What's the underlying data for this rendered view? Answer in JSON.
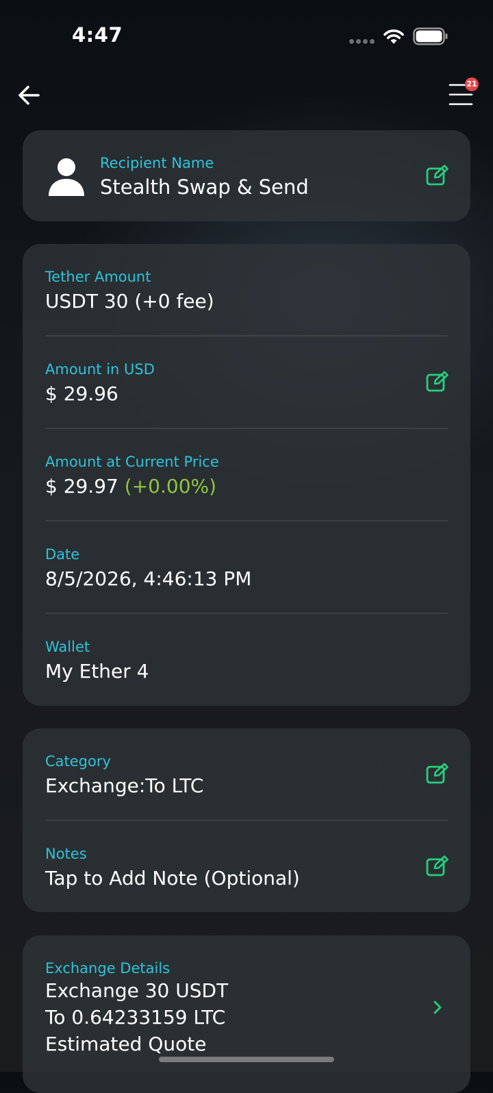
{
  "status_bar": {
    "time": "4:47"
  },
  "nav": {
    "back_icon": "arrow-left-icon",
    "menu_icon": "hamburger-menu-icon",
    "notification_count": "21"
  },
  "recipient": {
    "label": "Recipient Name",
    "value": "Stealth Swap & Send"
  },
  "amounts": {
    "tether_amount": {
      "label": "Tether Amount",
      "value": "USDT 30 (+0 fee)"
    },
    "amount_usd": {
      "label": "Amount in USD",
      "value": "$ 29.96"
    },
    "amount_current": {
      "label": "Amount at Current Price",
      "value": "$ 29.97",
      "change": "(+0.00%)"
    },
    "date": {
      "label": "Date",
      "value": "8/5/2026, 4:46:13 PM"
    },
    "wallet": {
      "label": "Wallet",
      "value": "My Ether 4"
    }
  },
  "meta": {
    "category": {
      "label": "Category",
      "value": "Exchange:To LTC"
    },
    "notes": {
      "label": "Notes",
      "value": "Tap to Add Note (Optional)"
    }
  },
  "exchange": {
    "label": "Exchange Details",
    "line1": "Exchange 30 USDT",
    "line2": "To 0.64233159 LTC",
    "line3": "Estimated Quote"
  },
  "colors": {
    "accent_label": "#2fc3da",
    "edit_icon": "#25d07e",
    "positive_change": "#8dc63f",
    "badge": "#e5484d"
  }
}
